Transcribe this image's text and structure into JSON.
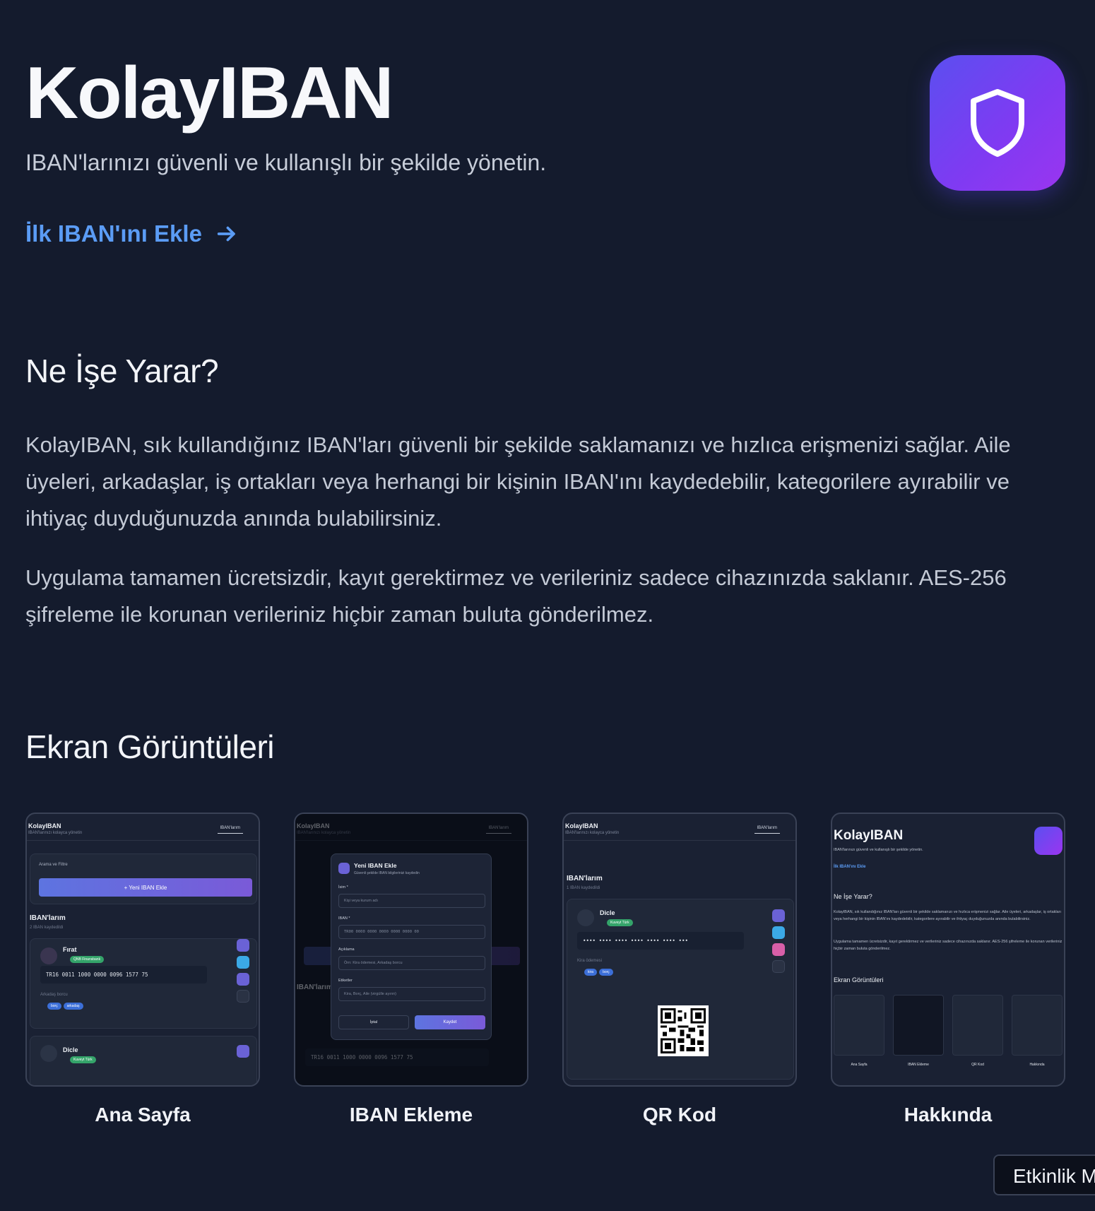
{
  "hero": {
    "title": "KolayIBAN",
    "subtitle": "IBAN'larınızı güvenli ve kullanışlı bir şekilde yönetin.",
    "cta_label": "İlk IBAN'ını Ekle"
  },
  "about": {
    "heading": "Ne İşe Yarar?",
    "paragraph_1": "KolayIBAN, sık kullandığınız IBAN'ları güvenli bir şekilde saklamanızı ve hızlıca erişmenizi sağlar. Aile üyeleri, arkadaşlar, iş ortakları veya herhangi bir kişinin IBAN'ını kaydedebilir, kategorilere ayırabilir ve ihtiyaç duyduğunuzda anında bulabilirsiniz.",
    "paragraph_2": "Uygulama tamamen ücretsizdir, kayıt gerektirmez ve verileriniz sadece cihazınızda saklanır. AES-256 şifreleme ile korunan verileriniz hiçbir zaman buluta gönderilmez."
  },
  "screenshots": {
    "heading": "Ekran Görüntüleri",
    "items": [
      {
        "label": "Ana Sayfa"
      },
      {
        "label": "IBAN Ekleme"
      },
      {
        "label": "QR Kod"
      },
      {
        "label": "Hakkında"
      }
    ]
  },
  "mini": {
    "brand": "KolayIBAN",
    "brand_sub": "IBAN'larınızı kolayca yönetin",
    "tab": "IBAN'larım",
    "search_filter": "Arama ve Filtre",
    "add_button": "+ Yeni IBAN Ekle",
    "list_title": "IBAN'larım",
    "count_2": "2 IBAN kaydedildi",
    "count_1": "1 IBAN kaydedildi",
    "entry_1": {
      "name": "Fırat",
      "bank": "QNB Finansbank",
      "iban": "TR16 0011 1000 0000 0096 1577 75",
      "note": "Arkadaş borcu",
      "tags": [
        "borç",
        "arkadaş"
      ]
    },
    "entry_2": {
      "name": "Dicle",
      "bank": "Kuveyt Türk",
      "masked": "•••• •••• •••• •••• •••• •••• •••",
      "note": "Kira ödemesi",
      "tags": [
        "kira",
        "borç"
      ]
    },
    "modal": {
      "title": "Yeni IBAN Ekle",
      "subtitle": "Güvenli şekilde IBAN bilgilerinizi kaydedin",
      "name_label": "İsim *",
      "name_ph": "Kişi veya kurum adı",
      "iban_label": "IBAN *",
      "iban_ph": "TR00 0000 0000 0000 0000 0000 00",
      "desc_label": "Açıklama",
      "desc_ph": "Örn: Kira ödemesi, Arkadaş borcu",
      "tags_label": "Etiketler",
      "tags_ph": "Kira, Borç, Aile (virgülle ayırın)",
      "cancel": "İptal",
      "save": "Kaydet"
    }
  },
  "tooltip": {
    "text": "Etkinlik M"
  },
  "colors": {
    "background": "#141b2d",
    "link": "#5b9cf5",
    "icon_gradient_start": "#5b4ff0",
    "icon_gradient_end": "#9a35f0"
  },
  "icons": [
    "shield-icon",
    "arrow-right-icon"
  ]
}
